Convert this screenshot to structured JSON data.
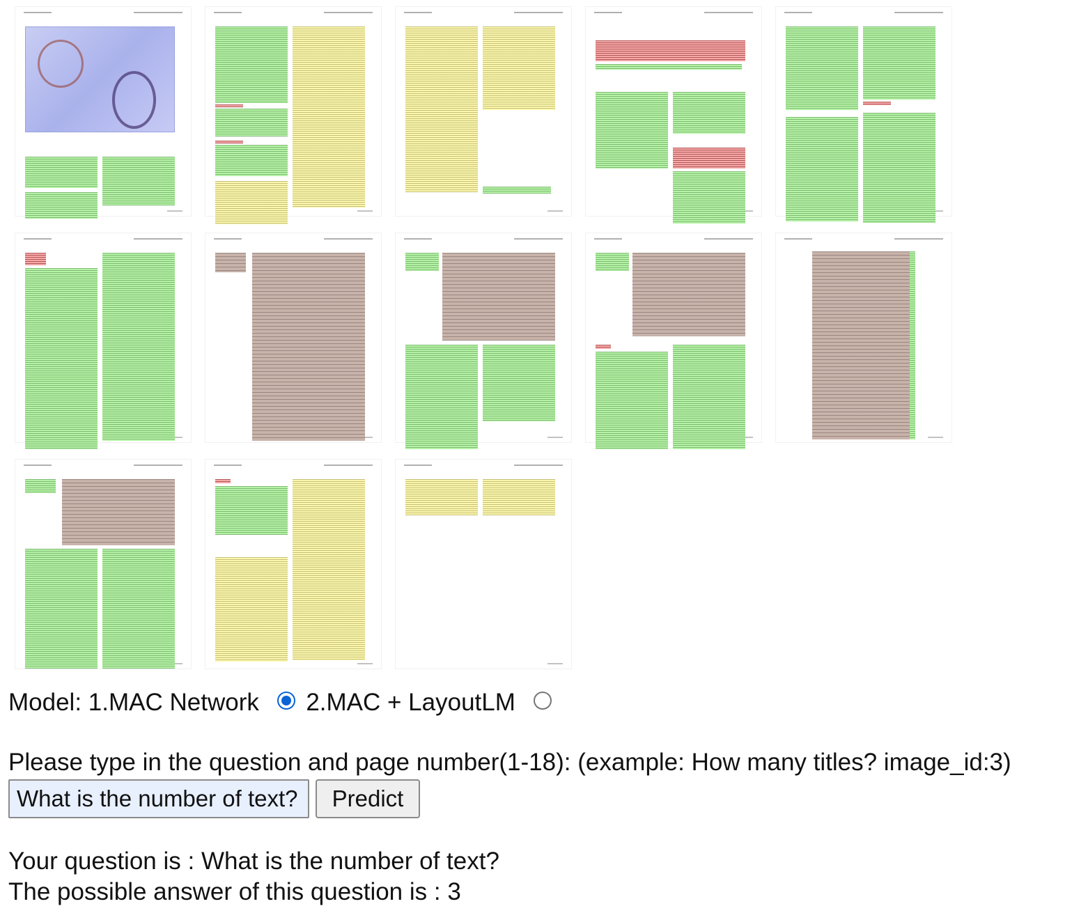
{
  "pages": [
    {
      "page": 1,
      "blocks": [
        [
          "figure",
          2,
          8,
          213,
          150
        ],
        [
          "text",
          2,
          195,
          104,
          45
        ],
        [
          "text",
          113,
          195,
          104,
          70
        ],
        [
          "text",
          2,
          246,
          104,
          38
        ]
      ]
    },
    {
      "page": 2,
      "blocks": [
        [
          "text",
          2,
          8,
          104,
          110
        ],
        [
          "title",
          2,
          120,
          40,
          4
        ],
        [
          "text",
          2,
          126,
          104,
          40
        ],
        [
          "title",
          2,
          172,
          40,
          4
        ],
        [
          "text",
          2,
          178,
          104,
          45
        ],
        [
          "list",
          2,
          230,
          104,
          62
        ],
        [
          "list",
          113,
          8,
          104,
          260
        ]
      ]
    },
    {
      "page": 3,
      "blocks": [
        [
          "list",
          2,
          8,
          104,
          238
        ],
        [
          "list",
          113,
          8,
          104,
          120
        ],
        [
          "text",
          113,
          238,
          98,
          10
        ]
      ]
    },
    {
      "page": 4,
      "blocks": [
        [
          "title",
          2,
          28,
          215,
          30
        ],
        [
          "text",
          2,
          62,
          210,
          8
        ],
        [
          "text",
          2,
          102,
          104,
          110
        ],
        [
          "text",
          113,
          102,
          104,
          60
        ],
        [
          "title",
          113,
          182,
          104,
          30
        ],
        [
          "text",
          113,
          216,
          104,
          75
        ]
      ]
    },
    {
      "page": 5,
      "blocks": [
        [
          "text",
          2,
          8,
          104,
          120
        ],
        [
          "text",
          2,
          138,
          104,
          150
        ],
        [
          "text",
          113,
          8,
          104,
          105
        ],
        [
          "title",
          113,
          116,
          40,
          5
        ],
        [
          "text",
          113,
          132,
          104,
          158
        ]
      ]
    }
  ],
  "pages_row2": [
    {
      "page": 6,
      "blocks": [
        [
          "title",
          2,
          8,
          30,
          18
        ],
        [
          "text",
          2,
          30,
          104,
          260
        ],
        [
          "text",
          113,
          8,
          104,
          270
        ]
      ]
    },
    {
      "page": 7,
      "blocks": [
        [
          "table",
          2,
          8,
          44,
          28
        ],
        [
          "table",
          55,
          8,
          162,
          270
        ]
      ]
    },
    {
      "page": 8,
      "blocks": [
        [
          "text",
          2,
          8,
          48,
          26
        ],
        [
          "table",
          55,
          8,
          162,
          126
        ],
        [
          "text",
          2,
          140,
          104,
          150
        ],
        [
          "text",
          113,
          140,
          104,
          110
        ]
      ]
    },
    {
      "page": 9,
      "blocks": [
        [
          "text",
          2,
          8,
          48,
          26
        ],
        [
          "table",
          55,
          8,
          162,
          120
        ],
        [
          "title",
          2,
          140,
          22,
          6
        ],
        [
          "text",
          2,
          150,
          104,
          140
        ],
        [
          "text",
          113,
          140,
          104,
          150
        ]
      ]
    },
    {
      "page": 10,
      "blocks": [
        [
          "table",
          40,
          6,
          140,
          270
        ],
        [
          "text",
          180,
          6,
          8,
          270
        ]
      ]
    }
  ],
  "pages_row3": [
    {
      "page": 11,
      "blocks": [
        [
          "text",
          2,
          8,
          44,
          20
        ],
        [
          "table",
          55,
          8,
          162,
          95
        ],
        [
          "text",
          2,
          108,
          104,
          172
        ],
        [
          "text",
          113,
          108,
          104,
          172
        ]
      ]
    },
    {
      "page": 12,
      "blocks": [
        [
          "title",
          2,
          8,
          22,
          6
        ],
        [
          "text",
          2,
          18,
          104,
          70
        ],
        [
          "list",
          2,
          120,
          104,
          150
        ],
        [
          "list",
          113,
          8,
          104,
          260
        ]
      ]
    },
    {
      "page": 13,
      "blocks": [
        [
          "list",
          2,
          8,
          104,
          52
        ],
        [
          "list",
          113,
          8,
          104,
          52
        ]
      ]
    }
  ],
  "controls": {
    "model_label": "Model:",
    "option1_label": "1.MAC Network",
    "option2_label": "2.MAC + LayoutLM",
    "selected_option": 1,
    "prompt_label": "Please type in the question and page number(1-18): (example: How many titles? image_id:3)",
    "question_value": "What is the number of text?",
    "predict_label": "Predict",
    "result_question_line": "Your question is : What is the number of text?",
    "result_answer_line": "The possible answer of this question is : 3"
  }
}
